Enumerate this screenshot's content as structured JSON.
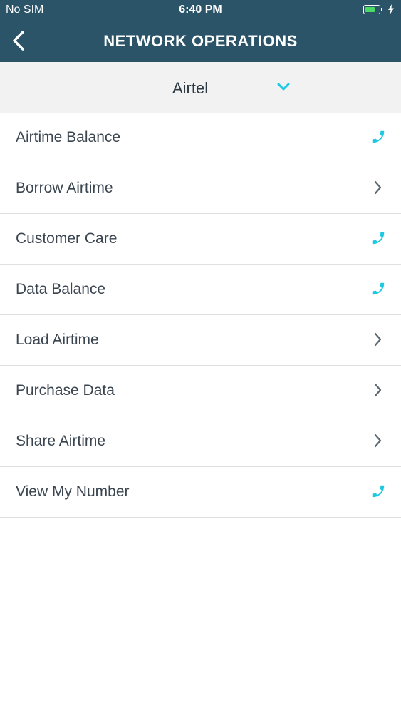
{
  "status_bar": {
    "carrier": "No SIM",
    "time": "6:40 PM",
    "battery_level": 0.75,
    "battery_color": "#4cd964"
  },
  "nav": {
    "title": "NETWORK OPERATIONS",
    "back_icon": "chevron-left-icon",
    "background": "#2b5468"
  },
  "network_selector": {
    "selected": "Airtel",
    "icon": "chevron-down-icon",
    "accent": "#1ec8e0"
  },
  "operations": [
    {
      "label": "Airtime Balance",
      "action_icon": "phone-icon"
    },
    {
      "label": "Borrow Airtime",
      "action_icon": "chevron-right-icon"
    },
    {
      "label": "Customer Care",
      "action_icon": "phone-icon"
    },
    {
      "label": "Data Balance",
      "action_icon": "phone-icon"
    },
    {
      "label": "Load Airtime",
      "action_icon": "chevron-right-icon"
    },
    {
      "label": "Purchase Data",
      "action_icon": "chevron-right-icon"
    },
    {
      "label": "Share Airtime",
      "action_icon": "chevron-right-icon"
    },
    {
      "label": "View My Number",
      "action_icon": "phone-icon"
    }
  ]
}
